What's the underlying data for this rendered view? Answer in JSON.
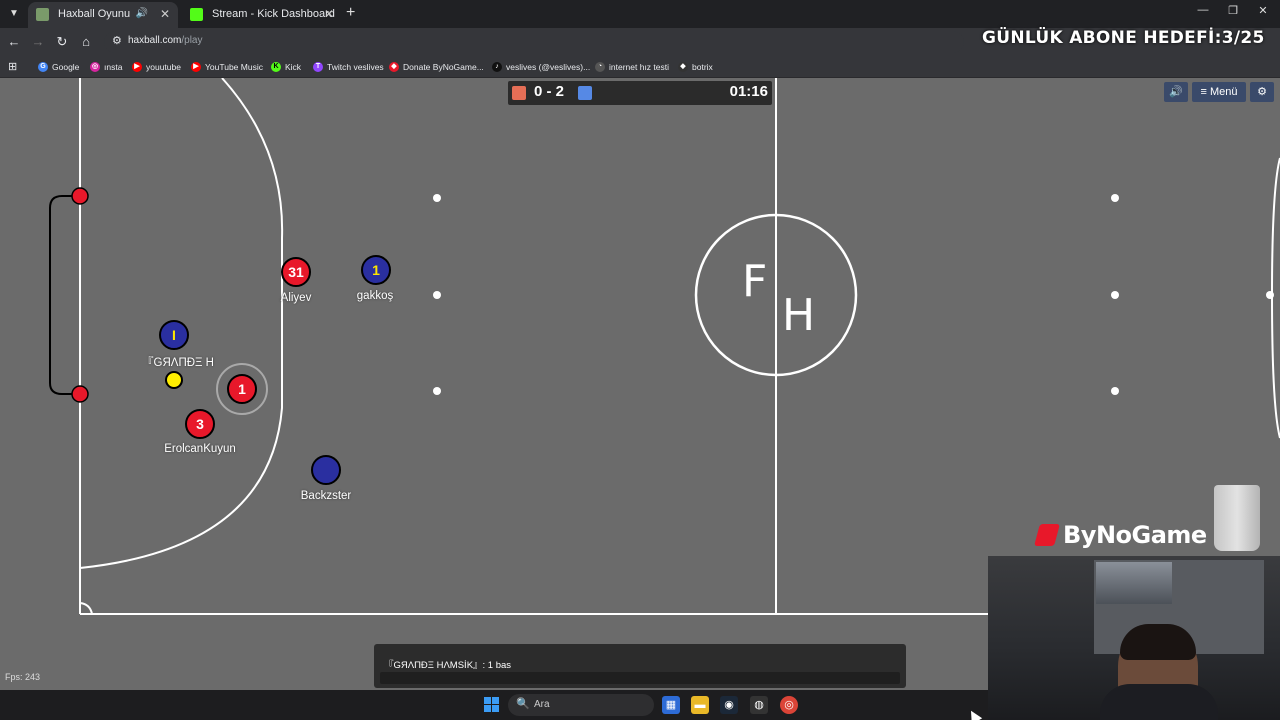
{
  "tabs": [
    {
      "title": "Haxball Oyunu",
      "active": true,
      "favicon_color": "#7a9a6a",
      "audio": true
    },
    {
      "title": "Stream - Kick Dashboard",
      "active": false,
      "favicon_color": "#53fc18",
      "audio": false
    }
  ],
  "newtab_label": "+",
  "window_controls": {
    "minimize": "—",
    "maximize": "❐",
    "close": "✕"
  },
  "nav": {
    "back": "←",
    "forward": "→",
    "reload": "↻",
    "home": "⌂"
  },
  "url": {
    "host": "haxball.com",
    "path": "/play"
  },
  "overlay_goal": "GÜNLÜK ABONE HEDEFİ:3/25",
  "bookmarks": [
    {
      "label": "Google",
      "icon": "G",
      "color": "#4285f4"
    },
    {
      "label": "ınsta",
      "icon": "◎",
      "color": "#d6249f"
    },
    {
      "label": "youutube",
      "icon": "▶",
      "color": "#ff0000"
    },
    {
      "label": "YouTube Music",
      "icon": "▶",
      "color": "#ff0000"
    },
    {
      "label": "Kick",
      "icon": "K",
      "color": "#53fc18"
    },
    {
      "label": "Twitch veslives",
      "icon": "T",
      "color": "#9146ff"
    },
    {
      "label": "Donate ByNoGame...",
      "icon": "◆",
      "color": "#e8182a"
    },
    {
      "label": "veslives (@veslives)...",
      "icon": "♪",
      "color": "#111111"
    },
    {
      "label": "internet hız testi",
      "icon": "◔",
      "color": "#555555"
    },
    {
      "label": "botrix",
      "icon": "◆",
      "color": "#333333"
    }
  ],
  "scoreboard": {
    "score": "0 - 2",
    "time": "01:16",
    "red_color": "#e56e56",
    "blue_color": "#5689e5"
  },
  "game_buttons": {
    "sound": "🔊",
    "menu": "≡ Menü",
    "settings": "⚙"
  },
  "center_logo": {
    "f": "F",
    "h": "H"
  },
  "players": [
    {
      "number": "31",
      "name": "Aliyev",
      "team": "red"
    },
    {
      "number": "1",
      "name": "gakkoş",
      "team": "blue"
    },
    {
      "number": "I",
      "name": "『GЯΛПÐΞ H",
      "team": "blue"
    },
    {
      "number": "1",
      "name": "",
      "team": "red"
    },
    {
      "number": "3",
      "name": "ErolcanKuyun",
      "team": "red"
    },
    {
      "number": "",
      "name": "Backzster",
      "team": "blue"
    }
  ],
  "fps": "Fps: 243",
  "chat": {
    "message": "『GЯΛПÐΞ HΛMSİK』: 1 bas"
  },
  "brand": "ByNoGame",
  "taskbar": {
    "search_placeholder": "Ara",
    "search_icon": "🔍"
  }
}
